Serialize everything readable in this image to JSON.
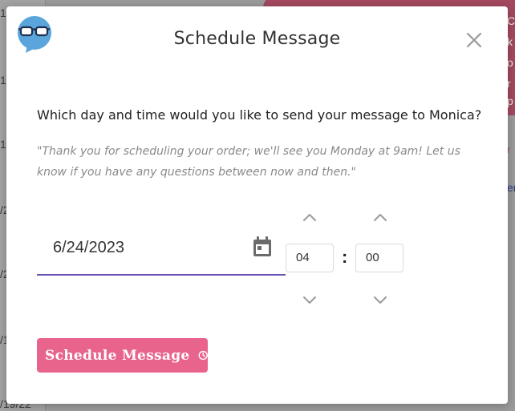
{
  "background": {
    "left_ticks": [
      "1",
      "1",
      "1",
      "/2",
      "/2",
      "/1",
      "/19/22"
    ],
    "right_snippets": [
      "C",
      "k",
      "o",
      "r",
      "p"
    ],
    "right_link_fragment": "er",
    "right_red_fragment": "r"
  },
  "modal": {
    "logo_icon": "glasses-speech-bubble-icon",
    "title": "Schedule Message",
    "close_icon": "close-icon",
    "question": "Which day and time would you like to send your message to Monica?",
    "quote": "\"Thank you for scheduling your order; we'll see you Monday at 9am! Let us know if you have any questions between now and then.\"",
    "date": {
      "value": "6/24/2023",
      "icon": "calendar-icon"
    },
    "time": {
      "hour": "04",
      "separator": ":",
      "minute": "00"
    },
    "schedule_button": {
      "label": "Schedule Message",
      "icon": "clock-icon"
    }
  },
  "colors": {
    "accent_purple": "#6a4fb3",
    "button_pink": "#e8648d",
    "logo_blue": "#5aa5dc"
  }
}
